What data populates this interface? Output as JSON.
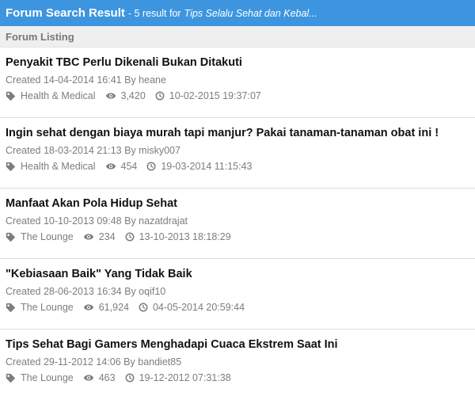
{
  "header": {
    "title": "Forum Search Result",
    "meta": "- 5 result for",
    "query": "Tips Selalu Sehat dan Kebal..."
  },
  "listing": {
    "label": "Forum Listing"
  },
  "results": [
    {
      "title": "Penyakit TBC Perlu Dikenali Bukan Ditakuti",
      "created": "Created 14-04-2014 16:41 By heane",
      "category": "Health & Medical",
      "views": "3,420",
      "last_post": "10-02-2015 19:37:07"
    },
    {
      "title": "Ingin sehat dengan biaya murah tapi manjur? Pakai tanaman-tanaman obat ini !",
      "created": "Created 18-03-2014 21:13 By misky007",
      "category": "Health & Medical",
      "views": "454",
      "last_post": "19-03-2014 11:15:43"
    },
    {
      "title": "Manfaat Akan Pola Hidup Sehat",
      "created": "Created 10-10-2013 09:48 By nazatdrajat",
      "category": "The Lounge",
      "views": "234",
      "last_post": "13-10-2013 18:18:29"
    },
    {
      "title": "\"Kebiasaan Baik\" Yang Tidak Baik",
      "created": "Created 28-06-2013 16:34 By oqif10",
      "category": "The Lounge",
      "views": "61,924",
      "last_post": "04-05-2014 20:59:44"
    },
    {
      "title": "Tips Sehat Bagi Gamers Menghadapi Cuaca Ekstrem Saat Ini",
      "created": "Created 29-11-2012 14:06 By bandiet85",
      "category": "The Lounge",
      "views": "463",
      "last_post": "19-12-2012 07:31:38"
    }
  ],
  "icons": {
    "category": "tag-icon",
    "views": "eye-icon",
    "last_post": "clock-icon"
  },
  "colors": {
    "header_bg": "#3d95e0",
    "subheader_bg": "#efefef",
    "meta_text": "#7d7d7d"
  }
}
